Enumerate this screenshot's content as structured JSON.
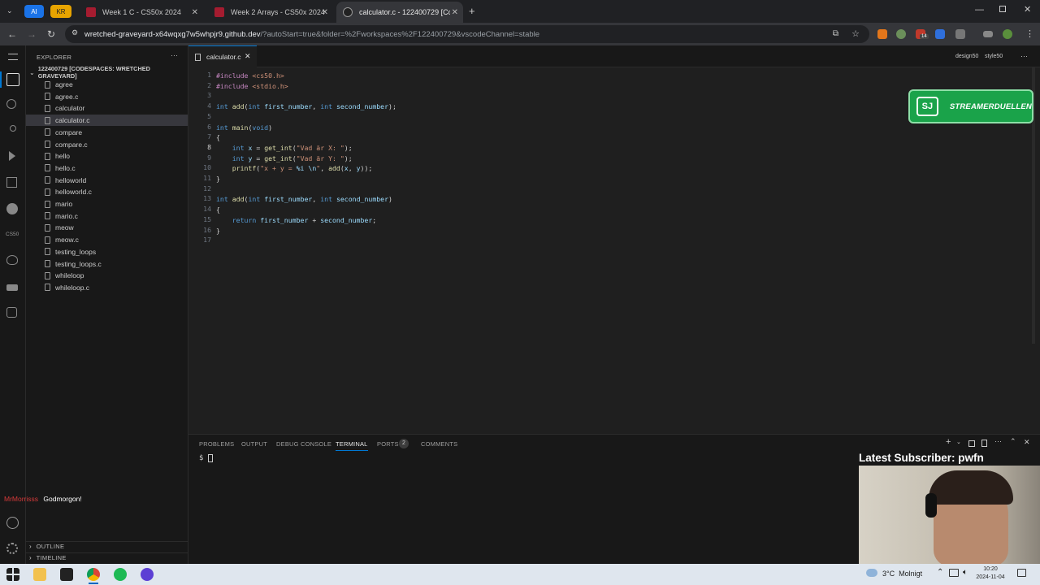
{
  "browser": {
    "pills": [
      {
        "label": "AI"
      },
      {
        "label": "KR"
      }
    ],
    "tabs": [
      {
        "title": "Week 1 C - CS50x 2024"
      },
      {
        "title": "Week 2 Arrays - CS50x 2024"
      },
      {
        "title": "calculator.c - 122400729 [Code"
      }
    ],
    "new_tab": "+",
    "url_host": "wretched-graveyard-x64wqxg7w5whpjr9.github.dev",
    "url_rest": "/?autoStart=true&folder=%2Fworkspaces%2F122400729&vscodeChannel=stable",
    "ext_badge": "14"
  },
  "explorer": {
    "title": "EXPLORER",
    "more": "···",
    "folder": "122400729 [CODESPACES: WRETCHED GRAVEYARD]",
    "files": [
      "agree",
      "agree.c",
      "calculator",
      "calculator.c",
      "compare",
      "compare.c",
      "hello",
      "hello.c",
      "helloworld",
      "helloworld.c",
      "mario",
      "mario.c",
      "meow",
      "meow.c",
      "testing_loops",
      "testing_loops.c",
      "whileloop",
      "whileloop.c"
    ],
    "selected": "calculator.c",
    "outline": "OUTLINE",
    "timeline": "TIMELINE",
    "activity_label": "CS50"
  },
  "editor": {
    "tab_label": "calculator.c",
    "right_actions": [
      "design50",
      "style50"
    ],
    "lines": [
      {
        "n": "1",
        "text": "#include <cs50.h>"
      },
      {
        "n": "2",
        "text": "#include <stdio.h>"
      },
      {
        "n": "3",
        "text": ""
      },
      {
        "n": "4",
        "text": "int add(int first_number, int second_number);"
      },
      {
        "n": "5",
        "text": ""
      },
      {
        "n": "6",
        "text": "int main(void)"
      },
      {
        "n": "7",
        "text": "{"
      },
      {
        "n": "8",
        "text": "    int x = get_int(\"Vad är X: \");"
      },
      {
        "n": "9",
        "text": "    int y = get_int(\"Vad är Y: \");"
      },
      {
        "n": "10",
        "text": "    printf(\"x + y = %i \\n\", add(x, y));"
      },
      {
        "n": "11",
        "text": "}"
      },
      {
        "n": "12",
        "text": ""
      },
      {
        "n": "13",
        "text": "int add(int first_number, int second_number)"
      },
      {
        "n": "14",
        "text": "{"
      },
      {
        "n": "15",
        "text": "    return first_number + second_number;"
      },
      {
        "n": "16",
        "text": "}"
      },
      {
        "n": "17",
        "text": ""
      }
    ]
  },
  "panel": {
    "tabs": [
      "PROBLEMS",
      "OUTPUT",
      "DEBUG CONSOLE",
      "TERMINAL",
      "PORTS",
      "COMMENTS"
    ],
    "ports_count": "2",
    "prompt": "$"
  },
  "overlay": {
    "logo_text": "STREAMERDUELLEN",
    "logo_mark": "SJ",
    "subscriber": "Latest Subscriber: pwfn",
    "chat_user": "MrMorrisss",
    "chat_msg": "Godmorgon!"
  },
  "taskbar": {
    "weather": "3°C  Molnigt",
    "time": "10:20",
    "date": "2024-11-04"
  },
  "colors": {
    "accent": "#0078d4",
    "selection": "#264f78",
    "sj_green": "#1aa34a"
  }
}
